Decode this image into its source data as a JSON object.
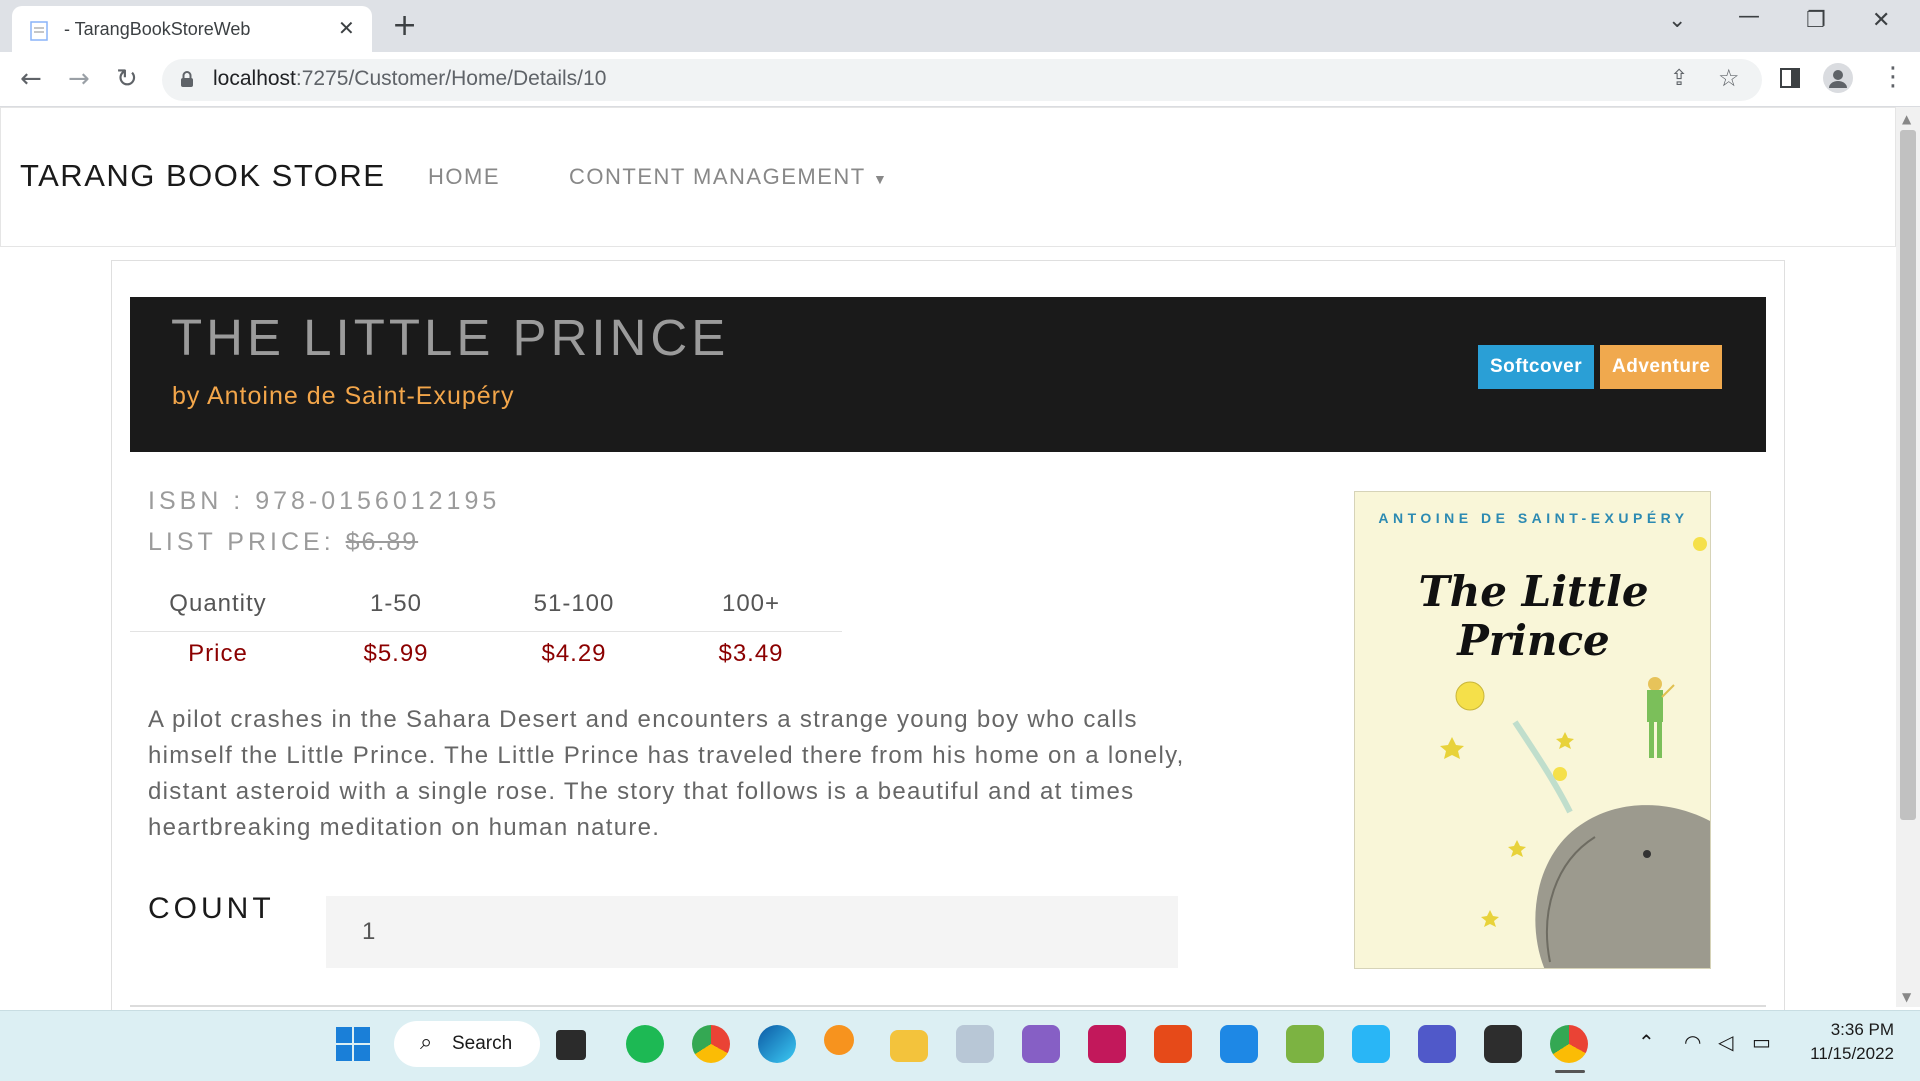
{
  "browser": {
    "tab_title": "- TarangBookStoreWeb",
    "url_host": "localhost",
    "url_path": ":7275/Customer/Home/Details/10"
  },
  "nav": {
    "brand": "TARANG BOOK STORE",
    "links": [
      "HOME",
      "CONTENT MANAGEMENT"
    ]
  },
  "book": {
    "title": "THE LITTLE PRINCE",
    "author": "by Antoine de Saint-Exupéry",
    "badges": [
      "Softcover",
      "Adventure"
    ],
    "isbn_label": "ISBN : ",
    "isbn": "978-0156012195",
    "list_price_label": "LIST PRICE: ",
    "list_price": "$6.89",
    "pricing": {
      "headers": [
        "Quantity",
        "1-50",
        "51-100",
        "100+"
      ],
      "row": [
        "Price",
        "$5.99",
        "$4.29",
        "$3.49"
      ]
    },
    "description": "A pilot crashes in the Sahara Desert and encounters a strange young boy who calls himself the Little Prince. The Little Prince has traveled there from his home on a lonely, distant asteroid with a single rose. The story that follows is a beautiful and at times heartbreaking meditation on human nature.",
    "count_label": "COUNT",
    "count_value": "1",
    "cover": {
      "author": "ANTOINE DE SAINT-EXUPÉRY",
      "title": "The Little Prince"
    }
  },
  "taskbar": {
    "search_label": "Search",
    "time": "3:36 PM",
    "date": "11/15/2022"
  },
  "colors": {
    "header_bg": "#1a1a1a",
    "author": "#f3a64a",
    "badge_softcover": "#2a9fd6",
    "badge_adventure": "#f0a94e",
    "price": "#8b0000"
  }
}
